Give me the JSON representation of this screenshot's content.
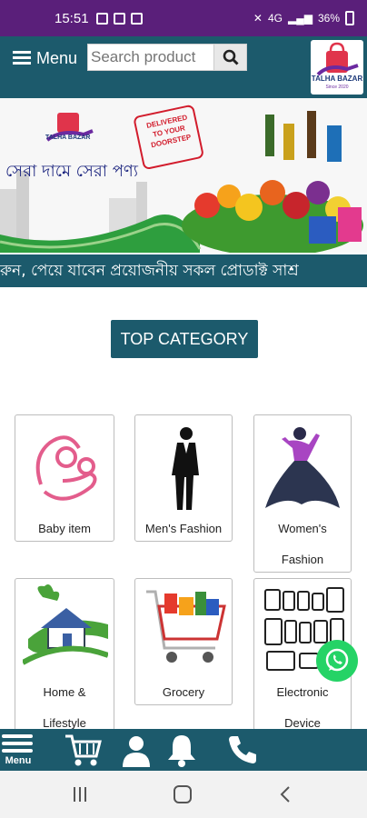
{
  "status_bar": {
    "time": "15:51",
    "battery": "36%"
  },
  "header": {
    "menu_label": "Menu",
    "search_placeholder": "Search product",
    "logo_text": "TALHA BAZAR",
    "logo_subtext": "Since 2020"
  },
  "banner": {
    "brand": "TALHA BAZAR",
    "tagline": "সেরা দামে সেরা পণ্য",
    "stamp_line1": "DELIVERED",
    "stamp_line2": "TO YOUR",
    "stamp_line3": "DOORSTEP"
  },
  "ticker_text": "রুন, পেয়ে যাবেন প্রয়োজনীয় সকল প্রোডাক্ট সাশ্র",
  "top_category_label": "TOP CATEGORY",
  "categories": [
    {
      "name": "Baby item",
      "icon": "baby-mother-icon"
    },
    {
      "name": "Men's Fashion",
      "icon": "man-suit-icon"
    },
    {
      "name": "Women's",
      "name2": "Fashion",
      "icon": "woman-dress-icon"
    },
    {
      "name": "Home &",
      "name2": "Lifestyle",
      "icon": "house-icon"
    },
    {
      "name": "Grocery",
      "icon": "grocery-cart-icon"
    },
    {
      "name": "Electronic",
      "name2": "Device",
      "icon": "devices-icon"
    }
  ],
  "bottom_nav": {
    "menu_label": "Menu"
  },
  "colors": {
    "primary": "#1c5a6c",
    "statusbar": "#5a1f7a",
    "whatsapp": "#25d366"
  }
}
